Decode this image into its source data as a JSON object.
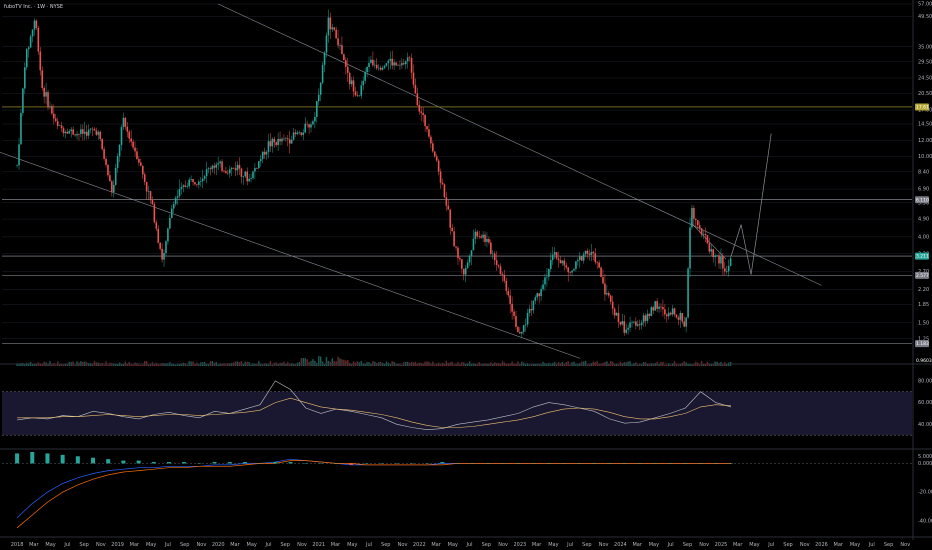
{
  "header": {
    "symbol": "fuboTV Inc. · 1W · NYSE"
  },
  "colors": {
    "up": "#26a69a",
    "down": "#ef5350",
    "grid": "#1e222d",
    "hline": "#9aa0a8",
    "trend": "#8a8f98",
    "rsi": "#bfc3c9",
    "rsi_ma": "#f0c36d",
    "rsi_band": "#1a1730",
    "macd": "#2962ff",
    "signal": "#ff6d00",
    "yellow_line": "#b5a934"
  },
  "chart_data": [
    {
      "type": "candlestick",
      "title": "fuboTV Inc. · 1W · NYSE",
      "scale": "log",
      "y_ticks": [
        "57.00",
        "49.50",
        "35.00",
        "29.50",
        "24.50",
        "20.50",
        "17.00",
        "14.50",
        "12.00",
        "10.00",
        "8.40",
        "6.90",
        "5.90",
        "4.90",
        "4.00",
        "3.30",
        "2.70",
        "2.20",
        "1.85",
        "1.50",
        "1.25"
      ],
      "x_ticks": [
        "2018",
        "Mar",
        "May",
        "Jul",
        "Sep",
        "Nov",
        "2019",
        "Mar",
        "May",
        "Jul",
        "Sep",
        "Nov",
        "2020",
        "Mar",
        "May",
        "Jul",
        "Sep",
        "Nov",
        "2021",
        "Mar",
        "May",
        "Jul",
        "Sep",
        "Nov",
        "2022",
        "Mar",
        "May",
        "Jul",
        "Sep",
        "Nov",
        "2023",
        "Mar",
        "May",
        "Jul",
        "Sep",
        "Nov",
        "2024",
        "Mar",
        "May",
        "Jul",
        "Sep",
        "Nov",
        "2025",
        "Mar",
        "May",
        "Jul",
        "Sep",
        "Nov",
        "2026",
        "Mar",
        "May",
        "Jul",
        "Sep",
        "Nov"
      ],
      "price_labels": [
        {
          "value": "17.61",
          "color": "#b5a934"
        },
        {
          "value": "6.110",
          "color": "#787b86"
        },
        {
          "value": "3.211",
          "color": "#26a69a"
        },
        {
          "value": "2.577",
          "color": "#787b86"
        },
        {
          "value": "1.183",
          "color": "#787b86"
        }
      ],
      "volume_label": "0.9603",
      "series": [
        {
          "name": "",
          "points": [
            [
              2018.0,
              9.0
            ],
            [
              2018.08,
              30.0
            ],
            [
              2018.18,
              49.0
            ],
            [
              2018.25,
              22.0
            ],
            [
              2018.4,
              14.0
            ],
            [
              2018.6,
              13.0
            ],
            [
              2018.8,
              13.5
            ],
            [
              2018.95,
              6.5
            ],
            [
              2019.05,
              15.0
            ],
            [
              2019.2,
              10.0
            ],
            [
              2019.35,
              5.5
            ],
            [
              2019.45,
              3.0
            ],
            [
              2019.55,
              6.0
            ],
            [
              2019.7,
              7.5
            ],
            [
              2019.85,
              8.0
            ],
            [
              2019.95,
              9.2
            ],
            [
              2020.1,
              8.5
            ],
            [
              2020.2,
              9.0
            ],
            [
              2020.3,
              7.6
            ],
            [
              2020.5,
              11.5
            ],
            [
              2020.65,
              12.0
            ],
            [
              2020.8,
              13.0
            ],
            [
              2020.95,
              15.0
            ],
            [
              2021.05,
              30.0
            ],
            [
              2021.1,
              48.0
            ],
            [
              2021.2,
              36.0
            ],
            [
              2021.3,
              24.0
            ],
            [
              2021.4,
              20.0
            ],
            [
              2021.5,
              30.0
            ],
            [
              2021.6,
              28.0
            ],
            [
              2021.7,
              30.0
            ],
            [
              2021.8,
              27.5
            ],
            [
              2021.9,
              31.0
            ],
            [
              2022.0,
              17.0
            ],
            [
              2022.1,
              13.0
            ],
            [
              2022.25,
              6.5
            ],
            [
              2022.35,
              3.6
            ],
            [
              2022.45,
              2.6
            ],
            [
              2022.55,
              4.2
            ],
            [
              2022.65,
              4.0
            ],
            [
              2022.8,
              2.8
            ],
            [
              2022.9,
              2.0
            ],
            [
              2023.0,
              1.25
            ],
            [
              2023.1,
              1.8
            ],
            [
              2023.2,
              2.2
            ],
            [
              2023.35,
              3.3
            ],
            [
              2023.5,
              2.6
            ],
            [
              2023.65,
              3.4
            ],
            [
              2023.75,
              3.1
            ],
            [
              2023.85,
              2.2
            ],
            [
              2023.95,
              1.65
            ],
            [
              2024.05,
              1.4
            ],
            [
              2024.15,
              1.5
            ],
            [
              2024.25,
              1.55
            ],
            [
              2024.35,
              1.9
            ],
            [
              2024.45,
              1.6
            ],
            [
              2024.55,
              1.7
            ],
            [
              2024.65,
              1.45
            ],
            [
              2024.7,
              5.8
            ],
            [
              2024.8,
              4.3
            ],
            [
              2024.9,
              3.4
            ],
            [
              2025.0,
              3.0
            ],
            [
              2025.05,
              2.6
            ],
            [
              2025.1,
              3.2
            ]
          ]
        }
      ],
      "projection": [
        [
          2025.1,
          3.2
        ],
        [
          2025.2,
          4.6
        ],
        [
          2025.3,
          2.6
        ],
        [
          2025.5,
          13.0
        ]
      ],
      "h_levels": [
        17.61,
        6.11,
        3.211,
        2.577,
        1.183
      ],
      "trendlines": [
        [
          [
            2020.0,
            57.0
          ],
          [
            2026.0,
            2.3
          ]
        ],
        [
          [
            2017.5,
            12.0
          ],
          [
            2023.6,
            1.0
          ]
        ],
        [
          [
            2024.7,
            4.7
          ],
          [
            2025.05,
            3.1
          ]
        ]
      ]
    },
    {
      "type": "line",
      "title": "",
      "ylabel": "",
      "y_ticks": [
        "80.00",
        "60.00",
        "40.00"
      ],
      "ylim": [
        20,
        90
      ],
      "bands": [
        70,
        30
      ],
      "series": [
        {
          "name": "",
          "values": [
            44,
            46,
            45,
            48,
            47,
            52,
            50,
            47,
            45,
            49,
            51,
            48,
            46,
            52,
            50,
            54,
            58,
            80,
            72,
            55,
            50,
            54,
            52,
            49,
            46,
            40,
            37,
            35,
            36,
            40,
            42,
            44,
            47,
            50,
            56,
            60,
            58,
            55,
            52,
            45,
            41,
            42,
            46,
            50,
            55,
            70,
            60,
            56
          ]
        },
        {
          "name": "",
          "values": [
            46,
            46,
            46,
            47,
            47,
            48,
            49,
            48,
            47,
            48,
            49,
            49,
            48,
            49,
            50,
            51,
            53,
            60,
            64,
            60,
            56,
            54,
            53,
            51,
            49,
            46,
            42,
            39,
            37,
            37,
            38,
            40,
            42,
            44,
            47,
            51,
            54,
            55,
            54,
            51,
            47,
            45,
            45,
            47,
            50,
            56,
            58,
            57
          ]
        }
      ]
    },
    {
      "type": "bar",
      "title": "",
      "ylabel": "",
      "y_ticks": [
        "5.0000",
        "0.0000",
        "-20.0000",
        "-40.0000"
      ],
      "ylim": [
        -50,
        8
      ],
      "series": [
        {
          "name": "",
          "values": [
            -38,
            -28,
            -20,
            -14,
            -10,
            -7,
            -5,
            -4,
            -3,
            -3,
            -2,
            -2,
            -2,
            -1,
            -1,
            0,
            0,
            1,
            3,
            2,
            1,
            0,
            -1,
            -1,
            -1,
            -1,
            -1,
            -1,
            0,
            0,
            0,
            0,
            0,
            0,
            0,
            0,
            0,
            0,
            0,
            0,
            0,
            0,
            0,
            0,
            0,
            0,
            0,
            0
          ]
        },
        {
          "name": "",
          "values": [
            -45,
            -36,
            -27,
            -20,
            -15,
            -11,
            -8,
            -6,
            -5,
            -4,
            -3,
            -3,
            -2,
            -2,
            -2,
            -1,
            0,
            0,
            2,
            2,
            1,
            0,
            0,
            -1,
            -1,
            -1,
            -1,
            -1,
            -1,
            0,
            0,
            0,
            0,
            0,
            0,
            0,
            0,
            0,
            0,
            0,
            0,
            0,
            0,
            0,
            0,
            0,
            0,
            0
          ]
        }
      ]
    }
  ]
}
